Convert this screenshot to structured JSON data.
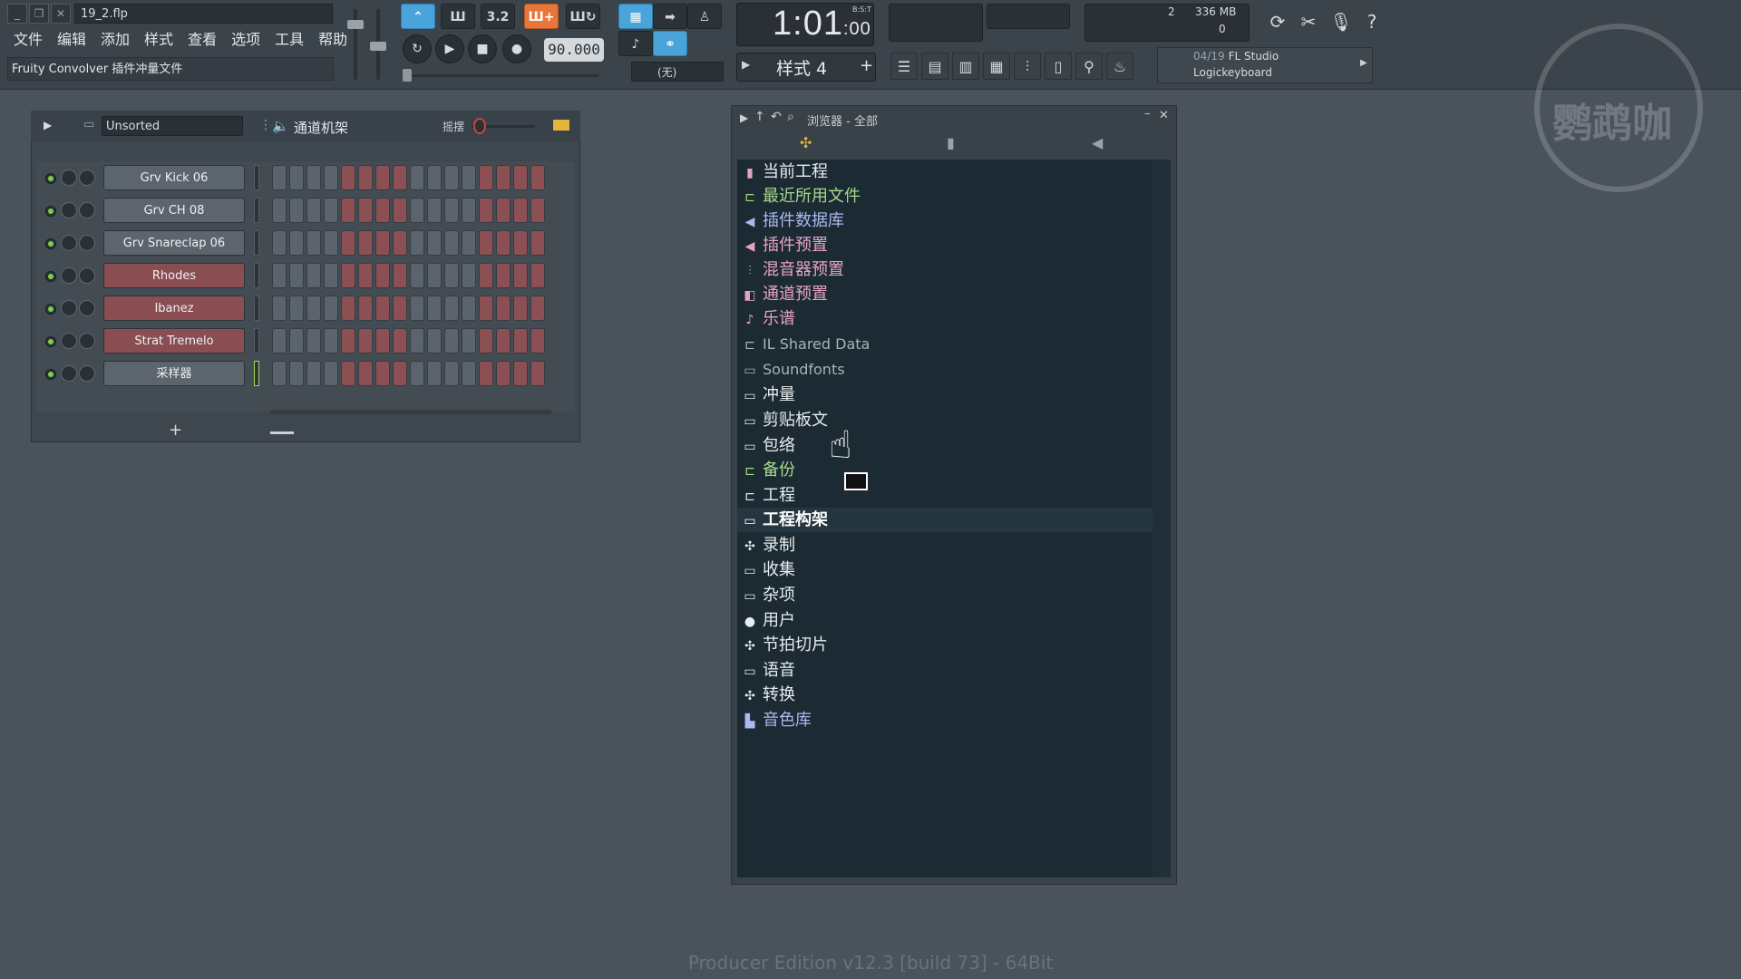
{
  "window": {
    "filename": "19_2.flp"
  },
  "menu": [
    "文件",
    "编辑",
    "添加",
    "样式",
    "查看",
    "选项",
    "工具",
    "帮助"
  ],
  "hint_bar": "Fruity Convolver 插件冲量文件",
  "transport": {
    "tempo": "90.000",
    "time_main": "1:01",
    "time_small": ":00",
    "time_unit": "B:S:T",
    "snap": "(无)",
    "pattern": "样式 4",
    "buttons": [
      "3.2"
    ]
  },
  "monitor": {
    "cpu_value": "2",
    "memory": "336 MB",
    "poly": "0"
  },
  "news": {
    "date": "04/19",
    "line1": "FL Studio",
    "line2": "Logickeyboard"
  },
  "channel_rack": {
    "filter": "Unsorted",
    "title": "通道机架",
    "swing_label": "摇摆",
    "add_label": "+",
    "channels": [
      {
        "name": "Grv Kick 06",
        "color": "grey"
      },
      {
        "name": "Grv CH 08",
        "color": "grey"
      },
      {
        "name": "Grv Snareclap 06",
        "color": "grey"
      },
      {
        "name": "Rhodes",
        "color": "red"
      },
      {
        "name": "Ibanez",
        "color": "red"
      },
      {
        "name": "Strat Tremelo",
        "color": "red"
      },
      {
        "name": "采样器",
        "color": "grey"
      }
    ]
  },
  "browser": {
    "title": "浏览器 - 全部",
    "items": [
      {
        "label": "当前工程",
        "icon": "project-icon",
        "style": "white"
      },
      {
        "label": "最近所用文件",
        "icon": "recent-folder-icon",
        "style": "green"
      },
      {
        "label": "插件数据库",
        "icon": "plugin-db-icon",
        "style": "blue"
      },
      {
        "label": "插件预置",
        "icon": "plugin-preset-icon",
        "style": "pink"
      },
      {
        "label": "混音器预置",
        "icon": "mixer-preset-icon",
        "style": "pink"
      },
      {
        "label": "通道预置",
        "icon": "channel-preset-icon",
        "style": "pink"
      },
      {
        "label": "乐谱",
        "icon": "score-icon",
        "style": "pink"
      },
      {
        "label": "IL Shared Data",
        "icon": "folder-link-icon",
        "style": "grey"
      },
      {
        "label": "Soundfonts",
        "icon": "folder-icon",
        "style": "grey"
      },
      {
        "label": "冲量",
        "icon": "folder-icon",
        "style": "white"
      },
      {
        "label": "剪贴板文",
        "icon": "folder-icon",
        "style": "white"
      },
      {
        "label": "包络",
        "icon": "folder-icon",
        "style": "white"
      },
      {
        "label": "备份",
        "icon": "backup-folder-icon",
        "style": "green"
      },
      {
        "label": "工程",
        "icon": "folder-link-icon",
        "style": "white"
      },
      {
        "label": "工程构架",
        "icon": "folder-icon",
        "style": "selected"
      },
      {
        "label": "录制",
        "icon": "record-icon",
        "style": "white"
      },
      {
        "label": "收集",
        "icon": "folder-icon",
        "style": "white"
      },
      {
        "label": "杂项",
        "icon": "folder-icon",
        "style": "white"
      },
      {
        "label": "用户",
        "icon": "user-icon",
        "style": "white"
      },
      {
        "label": "节拍切片",
        "icon": "slice-icon",
        "style": "white"
      },
      {
        "label": "语音",
        "icon": "folder-icon",
        "style": "white"
      },
      {
        "label": "转换",
        "icon": "convert-icon",
        "style": "white"
      },
      {
        "label": "音色库",
        "icon": "library-icon",
        "style": "blue"
      }
    ]
  },
  "footer": "Producer Edition v12.3 [build 73] - 64Bit",
  "colors": {
    "background": "#4a535c",
    "accent_blue": "#4aa3d9",
    "accent_orange": "#e8763a",
    "browser_bg": "#1b2a33"
  }
}
